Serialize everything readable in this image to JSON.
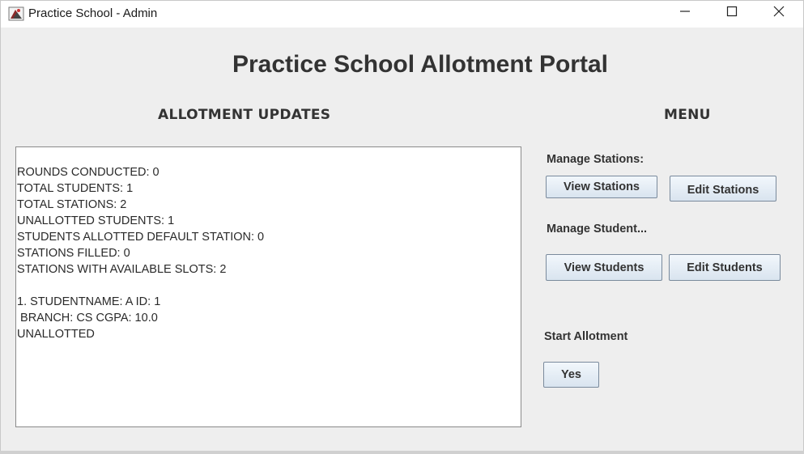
{
  "window": {
    "title": "Practice School - Admin",
    "app_icon": "java-app-icon",
    "controls": [
      "minimize-icon",
      "maximize-icon",
      "close-icon"
    ]
  },
  "header": {
    "title": "Practice School Allotment Portal"
  },
  "updates": {
    "heading": "ALLOTMENT UPDATES",
    "lines": [
      "ROUNDS CONDUCTED: 0",
      "TOTAL STUDENTS: 1",
      "TOTAL STATIONS: 2",
      "UNALLOTTED STUDENTS: 1",
      "STUDENTS ALLOTTED DEFAULT STATION: 0",
      "STATIONS FILLED: 0",
      "STATIONS WITH AVAILABLE SLOTS: 2",
      "",
      "1. STUDENTNAME: A ID: 1",
      " BRANCH: CS CGPA: 10.0",
      "UNALLOTTED"
    ]
  },
  "menu": {
    "heading": "MENU",
    "stations_label": "Manage Stations:",
    "view_stations": "View Stations",
    "edit_stations": "Edit Stations",
    "students_label": "Manage Student...",
    "view_students": "View Students",
    "edit_students": "Edit Students",
    "start_label": "Start Allotment",
    "yes": "Yes"
  },
  "colors": {
    "window_bg": "#eeeeee",
    "titlebar_bg": "#ffffff",
    "text": "#333333",
    "button_top": "#f2f7fc",
    "button_bottom": "#d9e4ef",
    "button_border": "#7a8a9c"
  }
}
